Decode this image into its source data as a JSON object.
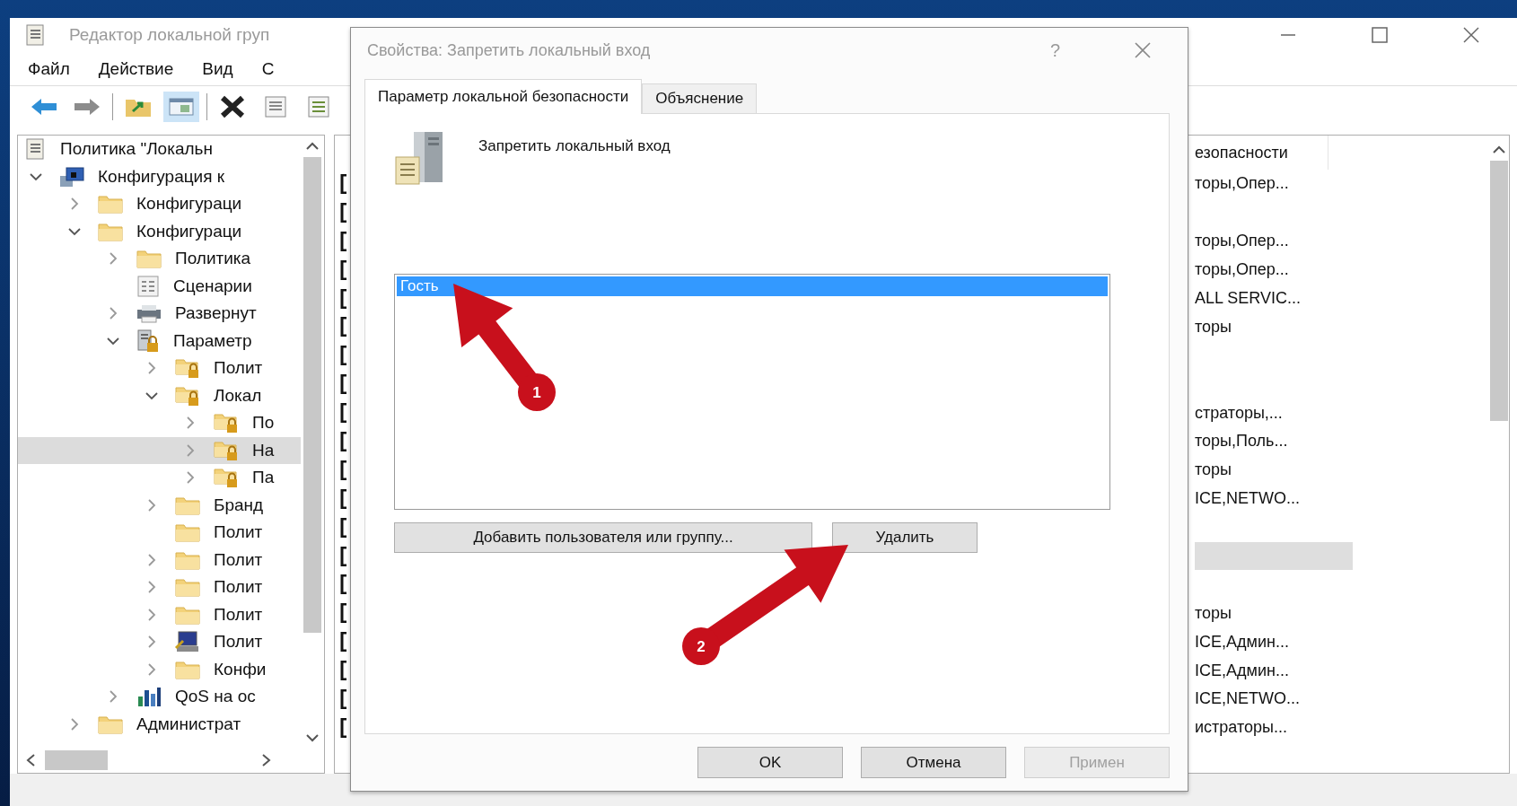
{
  "window": {
    "title": "Редактор локальной груп"
  },
  "menu": [
    {
      "label": "Файл"
    },
    {
      "label": "Действие"
    },
    {
      "label": "Вид"
    },
    {
      "label": "С"
    }
  ],
  "toolbar": [
    {
      "kind": "back",
      "pressed": false
    },
    {
      "kind": "forward",
      "pressed": false
    },
    {
      "kind": "separator"
    },
    {
      "kind": "folder-up",
      "pressed": false
    },
    {
      "kind": "pane",
      "pressed": true
    },
    {
      "kind": "separator"
    },
    {
      "kind": "delete",
      "pressed": false
    },
    {
      "kind": "properties",
      "pressed": false
    },
    {
      "kind": "list",
      "pressed": false
    }
  ],
  "tree": {
    "items": [
      {
        "label": "Политика \"Локальн",
        "kind": "scroll",
        "selected": false,
        "children": [
          {
            "label": "Конфигурация к",
            "kind": "computer",
            "expanded": true,
            "selected": false,
            "children": [
              {
                "label": "Конфигураци",
                "kind": "folder",
                "expanded": false,
                "selected": false
              },
              {
                "label": "Конфигураци",
                "kind": "folder",
                "expanded": true,
                "selected": false,
                "children": [
                  {
                    "label": "Политика",
                    "kind": "folder",
                    "expanded": false,
                    "selected": false
                  },
                  {
                    "label": "Сценарии",
                    "kind": "scripts",
                    "selected": false
                  },
                  {
                    "label": "Развернут",
                    "kind": "printer",
                    "expanded": false,
                    "selected": false
                  },
                  {
                    "label": "Параметр",
                    "kind": "security",
                    "expanded": true,
                    "selected": false,
                    "children": [
                      {
                        "label": "Полит",
                        "kind": "lock-folder",
                        "expanded": false,
                        "selected": false
                      },
                      {
                        "label": "Локал",
                        "kind": "lock-folder",
                        "expanded": true,
                        "selected": false,
                        "children": [
                          {
                            "label": "По",
                            "kind": "lock-folder",
                            "expanded": false,
                            "selected": false
                          },
                          {
                            "label": "На",
                            "kind": "lock-folder",
                            "expanded": false,
                            "selected": true
                          },
                          {
                            "label": "Па",
                            "kind": "lock-folder",
                            "expanded": false,
                            "selected": false
                          }
                        ]
                      },
                      {
                        "label": "Бранд",
                        "kind": "folder",
                        "expanded": false,
                        "selected": false
                      },
                      {
                        "label": "Полит",
                        "kind": "folder",
                        "selected": false
                      },
                      {
                        "label": "Полит",
                        "kind": "folder",
                        "expanded": false,
                        "selected": false
                      },
                      {
                        "label": "Полит",
                        "kind": "folder",
                        "expanded": false,
                        "selected": false
                      },
                      {
                        "label": "Полит",
                        "kind": "folder",
                        "expanded": false,
                        "selected": false
                      },
                      {
                        "label": "Полит",
                        "kind": "monitor",
                        "expanded": false,
                        "selected": false
                      },
                      {
                        "label": "Конфи",
                        "kind": "folder",
                        "expanded": false,
                        "selected": false
                      }
                    ]
                  },
                  {
                    "label": "QoS на ос",
                    "kind": "chart",
                    "expanded": false,
                    "selected": false
                  }
                ]
              },
              {
                "label": "Администрат",
                "kind": "folder",
                "expanded": false,
                "selected": false
              }
            ]
          }
        ]
      }
    ]
  },
  "details": {
    "header": "езопасности",
    "rows": [
      {
        "value": "торы,Опер...",
        "selected": false
      },
      {
        "selected": false
      },
      {
        "value": "торы,Опер...",
        "selected": false
      },
      {
        "value": "торы,Опер...",
        "selected": false
      },
      {
        "value": "ALL SERVIC...",
        "selected": false
      },
      {
        "value": "торы",
        "selected": false
      },
      {
        "selected": false
      },
      {
        "selected": false
      },
      {
        "value": "страторы,...",
        "selected": false
      },
      {
        "value": "торы,Поль...",
        "selected": false
      },
      {
        "value": "торы",
        "selected": false
      },
      {
        "value": "ICE,NETWO...",
        "selected": false
      },
      {
        "selected": false
      },
      {
        "selected": true
      },
      {
        "selected": false
      },
      {
        "value": "торы",
        "selected": false
      },
      {
        "value": "ICE,Админ...",
        "selected": false
      },
      {
        "value": "ICE,Админ...",
        "selected": false
      },
      {
        "value": "ICE,NETWO...",
        "selected": false
      },
      {
        "value": "истраторы...",
        "selected": false
      }
    ]
  },
  "dialog": {
    "title": "Свойства: Запретить локальный вход",
    "help": "?",
    "tabs": [
      {
        "label": "Параметр локальной безопасности",
        "selected": true
      },
      {
        "label": "Объяснение",
        "selected": false
      }
    ],
    "policy_name": "Запретить локальный вход",
    "members": [
      {
        "name": "Гость",
        "selected": true
      }
    ],
    "buttons": [
      {
        "label": "Добавить пользователя или группу..."
      },
      {
        "label": "Удалить"
      }
    ],
    "footer_buttons": [
      {
        "label": "OK",
        "disabled": false
      },
      {
        "label": "Отмена",
        "disabled": false
      },
      {
        "label": "Примен",
        "disabled": true
      }
    ]
  },
  "annotations": [
    {
      "number": "1"
    },
    {
      "number": "2"
    }
  ]
}
